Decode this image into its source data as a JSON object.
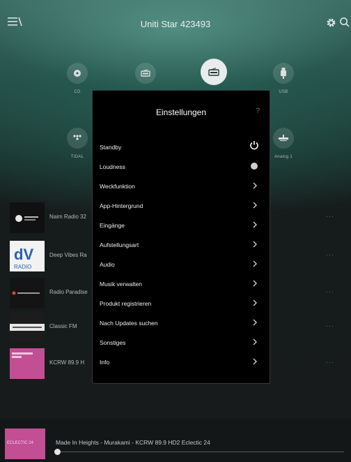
{
  "header": {
    "title": "Uniti Star 423493"
  },
  "sources": [
    {
      "label": "CD",
      "icon": "disc-icon"
    },
    {
      "label": "",
      "icon": "radio-icon"
    },
    {
      "label": "",
      "icon": "radio-selected-icon",
      "selected": true
    },
    {
      "label": "USB",
      "icon": "usb-icon"
    },
    {
      "label": "TIDAL",
      "icon": "tidal-icon"
    },
    {
      "label": "Analog 1",
      "icon": "analog-icon"
    }
  ],
  "stations": [
    {
      "name": "Naim Radio 32",
      "more": "···"
    },
    {
      "name": "Deep Vibes Ra",
      "more": "···"
    },
    {
      "name": "Radio Paradise",
      "more": "···"
    },
    {
      "name": "Classic FM",
      "more": "···"
    },
    {
      "name": "KCRW 89.9 H",
      "more": "···"
    }
  ],
  "settings": {
    "title": "Einstellungen",
    "help": "?",
    "items": [
      {
        "label": "Standby",
        "control": "power"
      },
      {
        "label": "Loudness",
        "control": "toggle"
      },
      {
        "label": "Weckfunktion",
        "control": "chevron"
      },
      {
        "label": "App-Hintergrund",
        "control": "chevron"
      },
      {
        "label": "Eingänge",
        "control": "chevron"
      },
      {
        "label": "Aufstellungsart",
        "control": "chevron"
      },
      {
        "label": "Audio",
        "control": "chevron"
      },
      {
        "label": "Musik verwalten",
        "control": "chevron"
      },
      {
        "label": "Produkt registrieren",
        "control": "chevron"
      },
      {
        "label": "Nach Updates suchen",
        "control": "chevron"
      },
      {
        "label": "Sonstiges",
        "control": "chevron"
      },
      {
        "label": "Info",
        "control": "chevron"
      }
    ]
  },
  "now_playing": {
    "text": "Made In Heights - Murakami - KCRW 89.9 HD2 Eclectic 24",
    "art_text": "ECLECTIC 24",
    "progress": 0.0
  },
  "colors": {
    "accent_pink": "#c24e94",
    "modal_bg": "#000000"
  }
}
